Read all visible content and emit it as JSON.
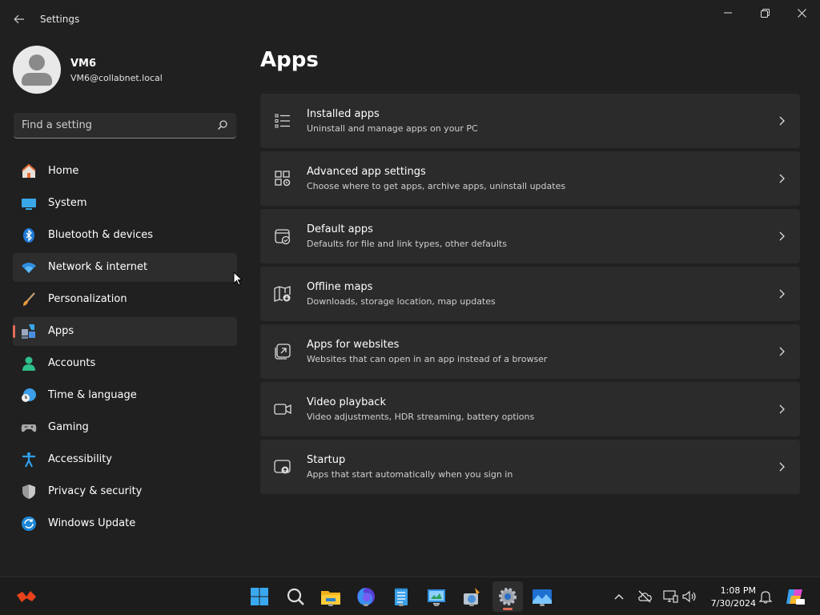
{
  "window": {
    "title": "Settings",
    "back_icon": "back-arrow-icon",
    "controls": [
      "minimize-icon",
      "restore-icon",
      "close-icon"
    ]
  },
  "profile": {
    "name": "VM6",
    "email": "VM6@collabnet.local"
  },
  "search": {
    "placeholder": "Find a setting"
  },
  "sidebar": {
    "items": [
      {
        "label": "Home",
        "icon": "home-icon"
      },
      {
        "label": "System",
        "icon": "system-icon"
      },
      {
        "label": "Bluetooth & devices",
        "icon": "bluetooth-icon"
      },
      {
        "label": "Network & internet",
        "icon": "wifi-icon",
        "state": "hover"
      },
      {
        "label": "Personalization",
        "icon": "brush-icon"
      },
      {
        "label": "Apps",
        "icon": "apps-icon",
        "state": "selected"
      },
      {
        "label": "Accounts",
        "icon": "accounts-icon"
      },
      {
        "label": "Time & language",
        "icon": "clock-globe-icon"
      },
      {
        "label": "Gaming",
        "icon": "gamepad-icon"
      },
      {
        "label": "Accessibility",
        "icon": "accessibility-icon"
      },
      {
        "label": "Privacy & security",
        "icon": "shield-icon"
      },
      {
        "label": "Windows Update",
        "icon": "update-icon"
      }
    ]
  },
  "main": {
    "title": "Apps",
    "cards": [
      {
        "title": "Installed apps",
        "desc": "Uninstall and manage apps on your PC",
        "icon": "list-icon"
      },
      {
        "title": "Advanced app settings",
        "desc": "Choose where to get apps, archive apps, uninstall updates",
        "icon": "app-settings-icon"
      },
      {
        "title": "Default apps",
        "desc": "Defaults for file and link types, other defaults",
        "icon": "default-apps-icon"
      },
      {
        "title": "Offline maps",
        "desc": "Downloads, storage location, map updates",
        "icon": "map-download-icon"
      },
      {
        "title": "Apps for websites",
        "desc": "Websites that can open in an app instead of a browser",
        "icon": "open-external-icon"
      },
      {
        "title": "Video playback",
        "desc": "Video adjustments, HDR streaming, battery options",
        "icon": "video-icon"
      },
      {
        "title": "Startup",
        "desc": "Apps that start automatically when you sign in",
        "icon": "startup-icon"
      }
    ]
  },
  "taskbar": {
    "apps": [
      "start-icon",
      "search-icon",
      "file-explorer-icon",
      "firefox-icon",
      "notepad-icon",
      "control-panel-icon",
      "disk-cleanup-icon",
      "settings-icon",
      "photos-icon"
    ],
    "tray": [
      "chevron-up-icon",
      "cloud-off-icon",
      "network-icon",
      "volume-icon",
      "notification-icon",
      "copilot-icon"
    ],
    "time": "1:08 PM",
    "date": "7/30/2024"
  },
  "colors": {
    "background": "#202020",
    "card": "#2b2b2b",
    "accent": "#e06c57",
    "taskbar": "#1c1c1c"
  }
}
